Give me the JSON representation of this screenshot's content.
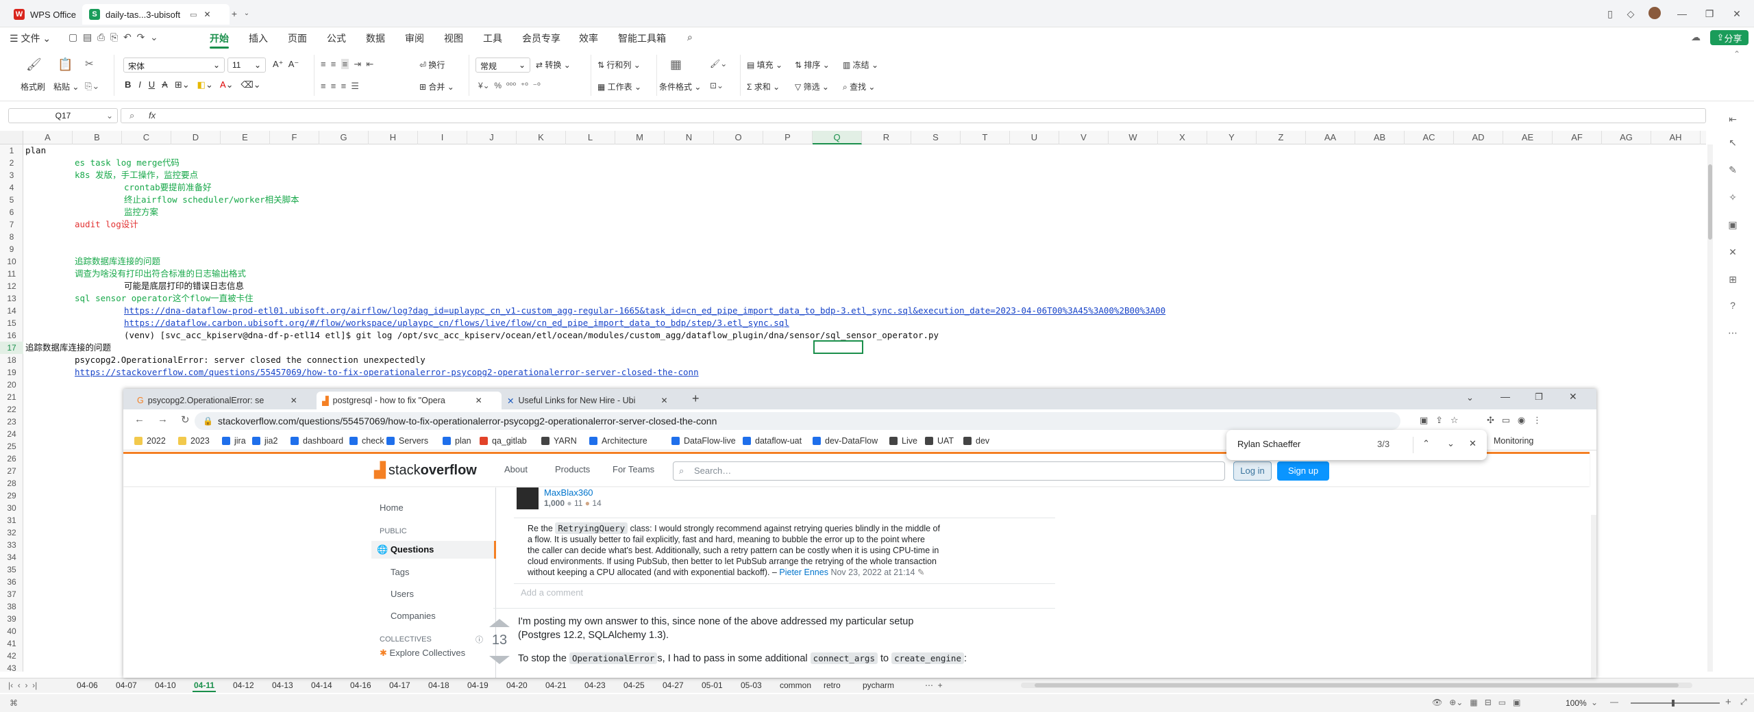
{
  "titlebar": {
    "tabs": [
      {
        "label": "WPS Office"
      },
      {
        "label": "daily-tas...3-ubisoft"
      }
    ]
  },
  "menu": {
    "file": "文件",
    "items": [
      "开始",
      "插入",
      "页面",
      "公式",
      "数据",
      "审阅",
      "视图",
      "工具",
      "会员专享",
      "效率",
      "智能工具箱"
    ],
    "share": "分享"
  },
  "ribbon": {
    "format_painter": "格式刷",
    "paste": "粘贴",
    "font_name": "宋体",
    "font_size": "11",
    "wrap": "换行",
    "merge": "合并",
    "number_format": "常规",
    "convert": "转换",
    "rows_cols": "行和列",
    "worksheet": "工作表",
    "cond_format": "条件格式",
    "fill": "填充",
    "sort": "排序",
    "freeze": "冻结",
    "sum": "求和",
    "filter": "筛选",
    "find": "查找"
  },
  "formula": {
    "cell_ref": "Q17",
    "fx": "fx",
    "value": ""
  },
  "columns": [
    "A",
    "B",
    "C",
    "D",
    "E",
    "F",
    "G",
    "H",
    "I",
    "J",
    "K",
    "L",
    "M",
    "N",
    "O",
    "P",
    "Q",
    "R",
    "S",
    "T",
    "U",
    "V",
    "W",
    "X",
    "Y",
    "Z",
    "AA",
    "AB",
    "AC",
    "AD",
    "AE",
    "AF",
    "AG",
    "AH"
  ],
  "selected_col": "Q",
  "selected_row": 17,
  "rows": [
    "1",
    "2",
    "3",
    "4",
    "5",
    "6",
    "7",
    "8",
    "9",
    "10",
    "11",
    "12",
    "13",
    "14",
    "15",
    "16",
    "17",
    "18",
    "19",
    "20",
    "21",
    "22",
    "23",
    "24",
    "25",
    "26",
    "27",
    "28",
    "29",
    "30",
    "31",
    "32",
    "33",
    "34",
    "35",
    "36",
    "37",
    "38",
    "39",
    "40",
    "41",
    "42",
    "43"
  ],
  "cells": [
    {
      "row": 1,
      "col": "A",
      "text": "plan",
      "style": "k"
    },
    {
      "row": 2,
      "col": "B",
      "text": "es task log merge代码",
      "style": "g"
    },
    {
      "row": 3,
      "col": "B",
      "text": "k8s 发版，手工操作，监控要点",
      "style": "g"
    },
    {
      "row": 4,
      "col": "C",
      "text": "crontab要提前准备好",
      "style": "g"
    },
    {
      "row": 5,
      "col": "C",
      "text": "终止airflow scheduler/worker相关脚本",
      "style": "g"
    },
    {
      "row": 6,
      "col": "C",
      "text": "监控方案",
      "style": "g"
    },
    {
      "row": 7,
      "col": "B",
      "text": "audit log设计",
      "style": "r"
    },
    {
      "row": 10,
      "col": "B",
      "text": "追踪数据库连接的问题",
      "style": "g"
    },
    {
      "row": 11,
      "col": "B",
      "text": "调查为啥没有打印出符合标准的日志输出格式",
      "style": "g"
    },
    {
      "row": 12,
      "col": "C",
      "text": "可能是底层打印的错误日志信息",
      "style": "k"
    },
    {
      "row": 13,
      "col": "B",
      "text": "sql sensor operator这个flow一直被卡住",
      "style": "g"
    },
    {
      "row": 14,
      "col": "C",
      "text": "https://dna-dataflow-prod-etl01.ubisoft.org/airflow/log?dag_id=uplaypc_cn_v1-custom_agg-regular-1665&task_id=cn_ed_pipe_import_data_to_bdp-3.etl_sync.sql&execution_date=2023-04-06T00%3A45%3A00%2B00%3A00",
      "style": "lnk"
    },
    {
      "row": 15,
      "col": "C",
      "text": "https://dataflow.carbon.ubisoft.org/#/flow/workspace/uplaypc_cn/flows/live/flow/cn_ed_pipe_import_data_to_bdp/step/3.etl_sync.sql",
      "style": "lnk"
    },
    {
      "row": 16,
      "col": "C",
      "text": "(venv) [svc_acc_kpiserv@dna-df-p-etl14 etl]$ git log /opt/svc_acc_kpiserv/ocean/etl/ocean/modules/custom_agg/dataflow_plugin/dna/sensor/sql_sensor_operator.py",
      "style": "k"
    },
    {
      "row": 17,
      "col": "A",
      "text": "追踪数据库连接的问题",
      "style": "k"
    },
    {
      "row": 18,
      "col": "B",
      "text": "psycopg2.OperationalError: server closed the connection unexpectedly",
      "style": "k"
    },
    {
      "row": 19,
      "col": "B",
      "text": "https://stackoverflow.com/questions/55457069/how-to-fix-operationalerror-psycopg2-operationalerror-server-closed-the-conn",
      "style": "lnk"
    }
  ],
  "sheets": [
    "04-06",
    "04-07",
    "04-10",
    "04-11",
    "04-12",
    "04-13",
    "04-14",
    "04-16",
    "04-17",
    "04-18",
    "04-19",
    "04-20",
    "04-21",
    "04-23",
    "04-25",
    "04-27",
    "05-01",
    "05-03",
    "common",
    "retro",
    "pycharm"
  ],
  "active_sheet": "04-11",
  "status": {
    "zoom": "100%"
  },
  "browser": {
    "tabs": [
      {
        "label": "psycopg2.OperationalError: se"
      },
      {
        "label": "postgresql - how to fix \"Opera"
      },
      {
        "label": "Useful Links for New Hire - Ubi"
      }
    ],
    "url": "stackoverflow.com/questions/55457069/how-to-fix-operationalerror-psycopg2-operationalerror-server-closed-the-conn",
    "bookmarks": [
      "2022",
      "2023",
      "jira",
      "jia2",
      "dashboard",
      "check",
      "Servers",
      "plan",
      "qa_gitlab",
      "YARN",
      "Architecture",
      "DataFlow-live",
      "dataflow-uat",
      "dev-DataFlow",
      "Live",
      "UAT",
      "dev"
    ],
    "bookmark_extra": "Monitoring",
    "find": {
      "query": "Rylan Schaeffer",
      "count": "3/3"
    }
  },
  "so": {
    "logo_main": "stack",
    "logo_bold": "overflow",
    "nav": [
      "About",
      "Products",
      "For Teams"
    ],
    "search_placeholder": "Search…",
    "login": "Log in",
    "signup": "Sign up",
    "sidebar": {
      "home": "Home",
      "public": "PUBLIC",
      "questions": "Questions",
      "tags": "Tags",
      "users": "Users",
      "companies": "Companies",
      "collectives": "COLLECTIVES",
      "explore": "Explore Collectives"
    },
    "user": {
      "name": "MaxBlax360",
      "rep": "1,000",
      "silver": "11",
      "bronze": "14"
    },
    "comment": {
      "pre": "Re the",
      "code": "RetryingQuery",
      "line1": "class: I would strongly recommend against retrying queries blindly in the middle of",
      "line2": "a flow. It is usually better to fail explicitly, fast and hard, meaning to bubble the error up to the point where",
      "line3": "the caller can decide what's best. Additionally, such a retry pattern can be costly when it is using CPU-time in",
      "line4": "cloud environments. If using PubSub, then better to let PubSub arrange the retrying of the whole transaction",
      "line5": "without keeping a CPU allocated (and with exponential backoff). –",
      "author": "Pieter Ennes",
      "date": "Nov 23, 2022 at 21:14"
    },
    "add_comment": "Add a comment",
    "votes": "13",
    "answer1": "I'm posting my own answer to this, since none of the above addressed my particular setup",
    "answer2": "(Postgres 12.2, SQLAlchemy 1.3).",
    "answer3_pre": "To stop the",
    "answer3_code1": "OperationalError",
    "answer3_mid": "s, I had to pass in some additional",
    "answer3_code2": "connect_args",
    "answer3_to": "to",
    "answer3_code3": "create_engine",
    "answer3_post": ":"
  }
}
